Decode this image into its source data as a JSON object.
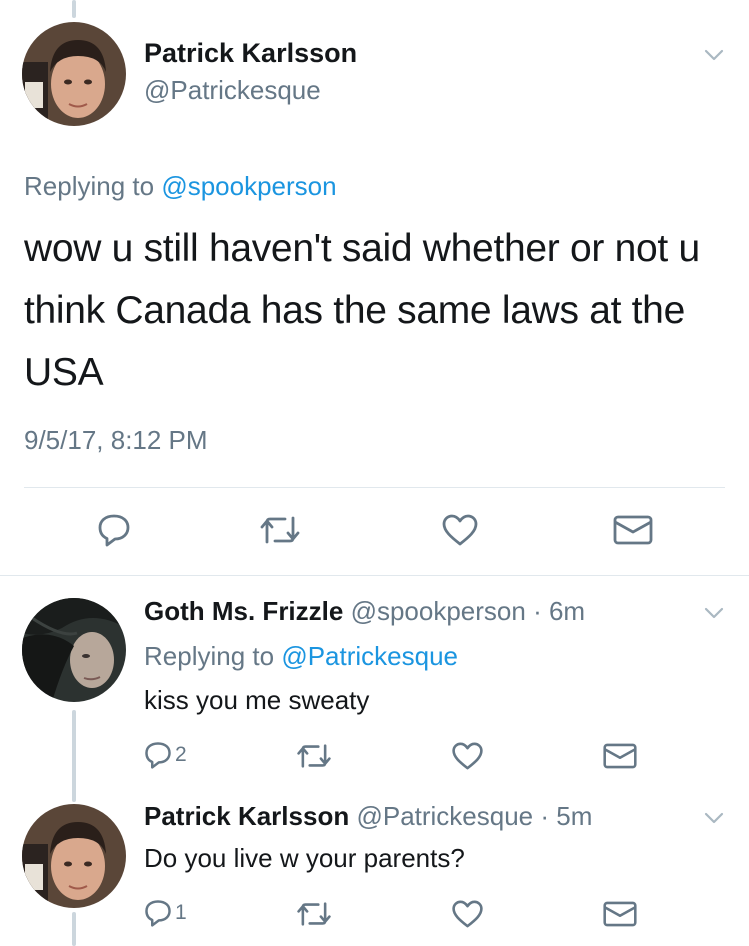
{
  "main_tweet": {
    "author_name": "Patrick Karlsson",
    "author_handle": "@Patrickesque",
    "replying_prefix": "Replying to ",
    "replying_handle": "@spookperson",
    "text": "wow u still haven't said whether or not u think Canada has the same laws at the USA",
    "timestamp": "9/5/17, 8:12 PM"
  },
  "replies": [
    {
      "author_name": "Goth Ms. Frizzle",
      "author_handle": "@spookperson",
      "time": "· 6m",
      "replying_prefix": "Replying to ",
      "replying_handle": "@Patrickesque",
      "text": "kiss you me sweaty",
      "reply_count": "2"
    },
    {
      "author_name": "Patrick Karlsson",
      "author_handle": "@Patrickesque",
      "time": "· 5m",
      "text": "Do you live w your parents?",
      "reply_count": "1"
    }
  ],
  "colors": {
    "link": "#1b95e0",
    "muted": "#657786",
    "divider": "#e1e8ed",
    "thread_line": "#ccd6dd"
  },
  "icons": [
    "reply-icon",
    "retweet-icon",
    "like-icon",
    "direct-message-icon",
    "chevron-down-icon"
  ]
}
